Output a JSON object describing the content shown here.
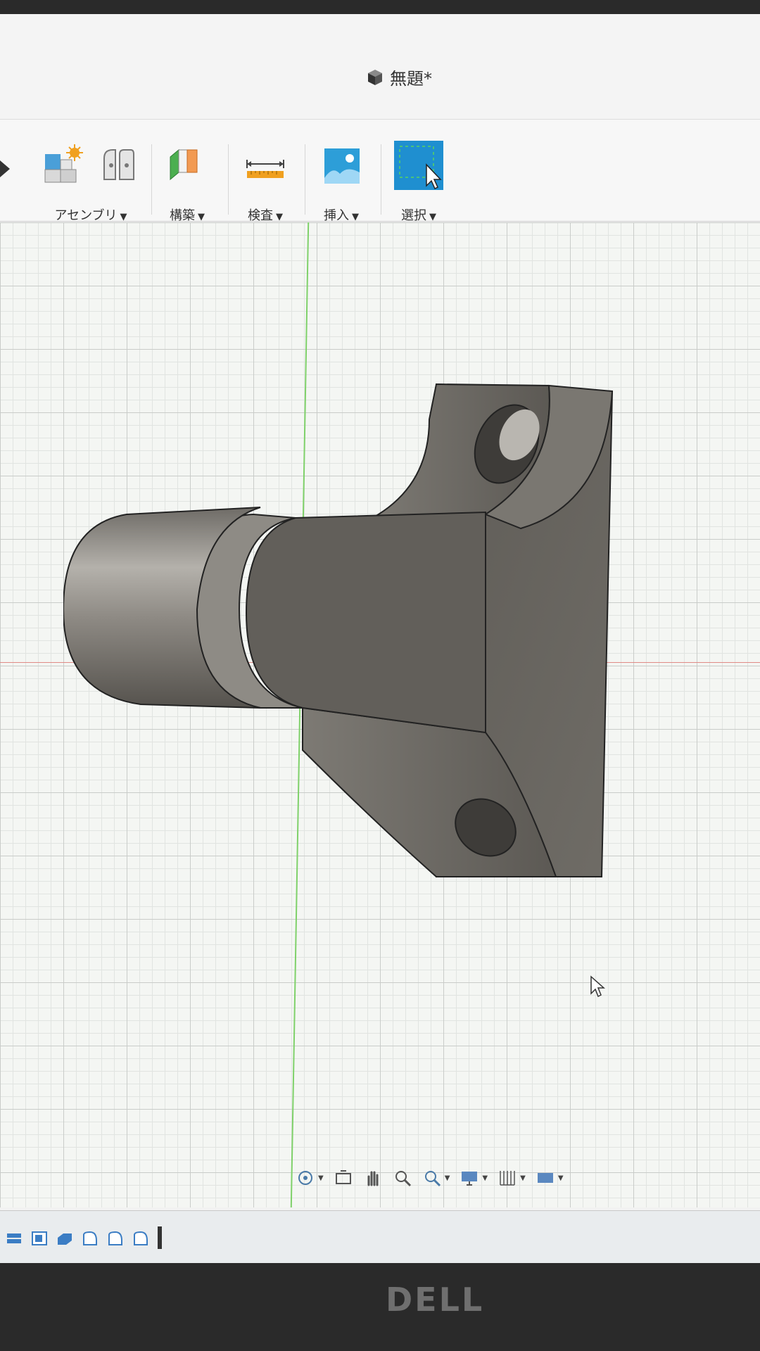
{
  "window": {
    "title": "無題*"
  },
  "toolbar": {
    "groups": [
      {
        "label": "アセンブリ",
        "icons": [
          "new-component-icon",
          "joint-icon"
        ]
      },
      {
        "label": "構築",
        "icons": [
          "construct-plane-icon"
        ]
      },
      {
        "label": "検査",
        "icons": [
          "measure-icon"
        ]
      },
      {
        "label": "挿入",
        "icons": [
          "insert-image-icon"
        ]
      },
      {
        "label": "選択",
        "icons": [
          "select-icon"
        ]
      }
    ]
  },
  "navbar": {
    "icons": [
      "orbit-icon",
      "look-at-icon",
      "pan-icon",
      "zoom-icon",
      "zoom-window-icon",
      "display-settings-icon",
      "grid-snap-icon",
      "viewports-icon"
    ]
  },
  "timeline": {
    "icons": [
      "component-icon",
      "sketch-icon",
      "extrude-icon",
      "fillet-icon",
      "fillet-icon",
      "fillet-icon"
    ]
  },
  "monitor": {
    "brand": "DELL"
  },
  "colors": {
    "accent": "#1f8fd0",
    "model": "#6a6761",
    "grid": "#c9ccc9",
    "axis_x": "#e08a86",
    "axis_y": "#7fd16a"
  }
}
